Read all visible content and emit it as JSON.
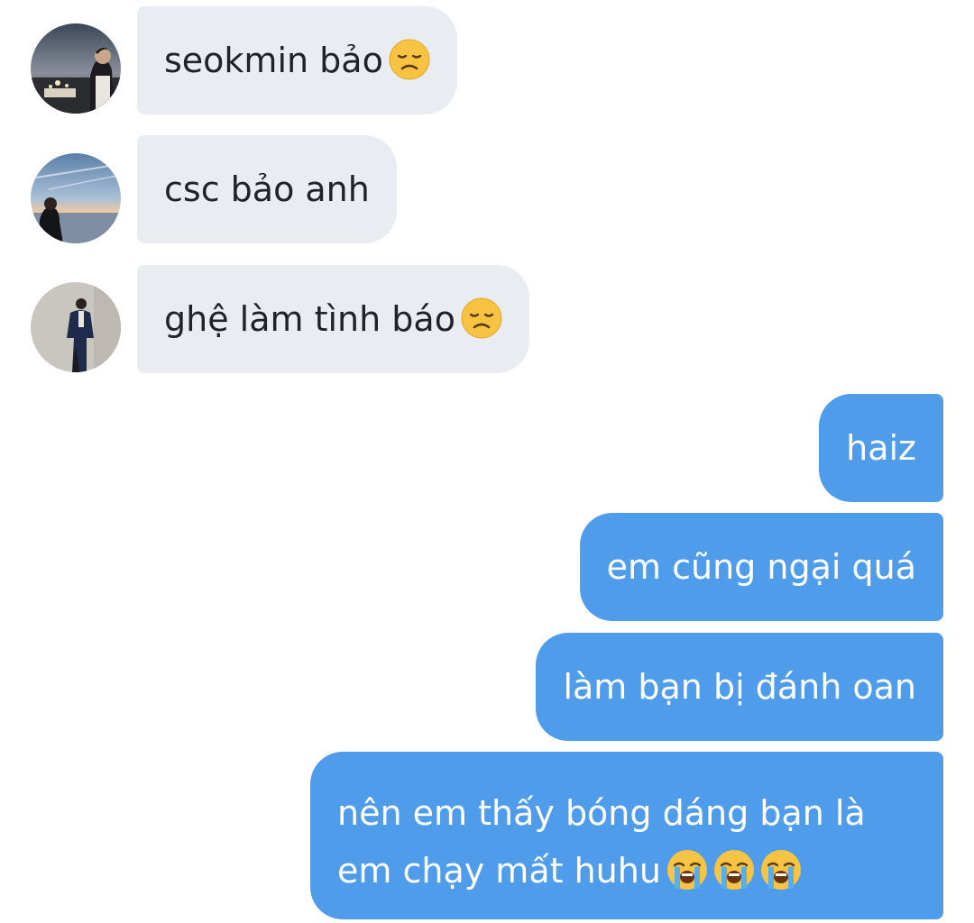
{
  "messages": [
    {
      "direction": "incoming",
      "text": "seokmin bảo",
      "emoji": "disappointed-face"
    },
    {
      "direction": "incoming",
      "text": "csc bảo anh",
      "emoji": ""
    },
    {
      "direction": "incoming",
      "text": "ghệ làm tình báo",
      "emoji": "disappointed-face"
    },
    {
      "direction": "outgoing",
      "text": "haiz"
    },
    {
      "direction": "outgoing",
      "text": "em cũng ngại quá"
    },
    {
      "direction": "outgoing",
      "text": "làm bạn bị đánh oan"
    },
    {
      "direction": "outgoing",
      "line1": "nên em thấy bóng dáng bạn là",
      "line2": "em chạy mất huhu",
      "emoji": "loudly-crying-face"
    }
  ],
  "colors": {
    "incoming_bubble": "#e9edf2",
    "outgoing_bubble": "#4f9cea",
    "incoming_text": "#1f2328",
    "outgoing_text": "#ffffff"
  }
}
